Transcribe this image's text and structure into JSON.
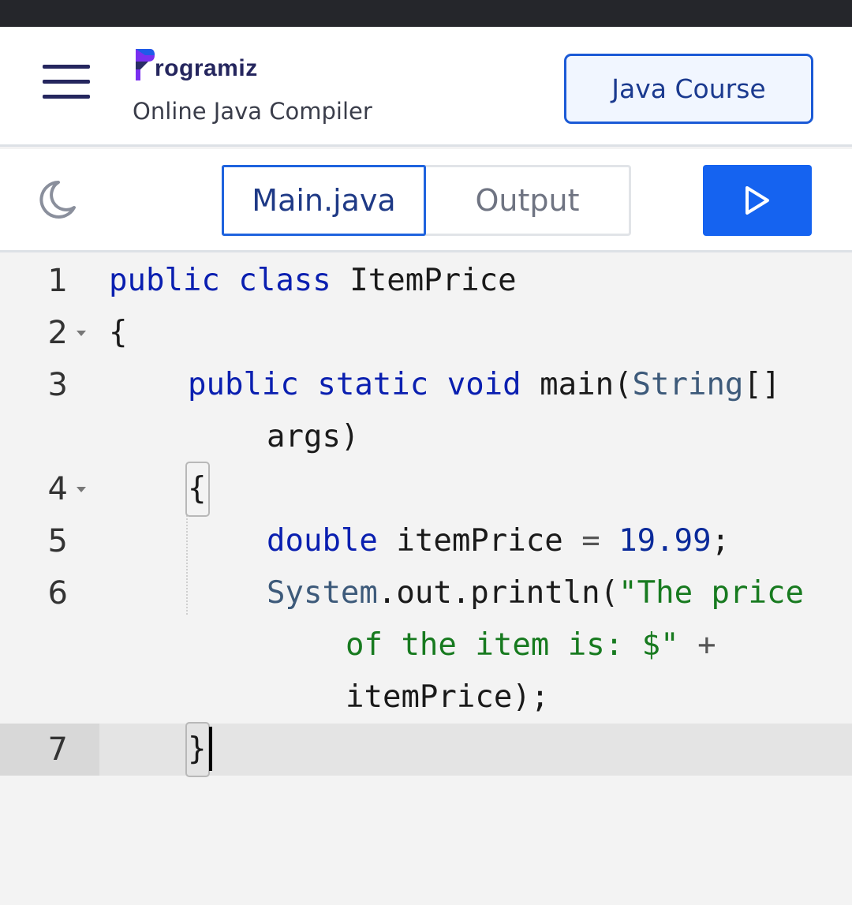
{
  "header": {
    "logo_text": "rogramiz",
    "subtitle": "Online Java Compiler",
    "course_button": "Java Course"
  },
  "toolbar": {
    "tabs": [
      {
        "label": "Main.java",
        "active": true
      },
      {
        "label": "Output",
        "active": false
      }
    ],
    "theme_icon": "moon-icon",
    "run_icon": "play-icon"
  },
  "editor": {
    "line_numbers": [
      "1",
      "2",
      "3",
      "4",
      "5",
      "6",
      "7"
    ],
    "code": {
      "l1_kw": "public class",
      "l1_name": "ItemPrice",
      "l2": "{",
      "l3_kw": "public static void",
      "l3_main": "main(",
      "l3_type": "String",
      "l3_rest": "[]",
      "l3_wrap": "args)",
      "l4": "{",
      "l5_kw": "double",
      "l5_name": "itemPrice",
      "l5_eq": "=",
      "l5_num": "19.99",
      "l5_end": ";",
      "l6_sys": "System",
      "l6_call": ".out.println(",
      "l6_str1": "\"The price",
      "l6_str2": "of the item is: $\"",
      "l6_plus": "+",
      "l6_end": "itemPrice);",
      "l7": "}"
    }
  },
  "colors": {
    "accent": "#1563f0",
    "keyword": "#0a1fb0",
    "string": "#177a1f",
    "brand": "#25265e"
  }
}
